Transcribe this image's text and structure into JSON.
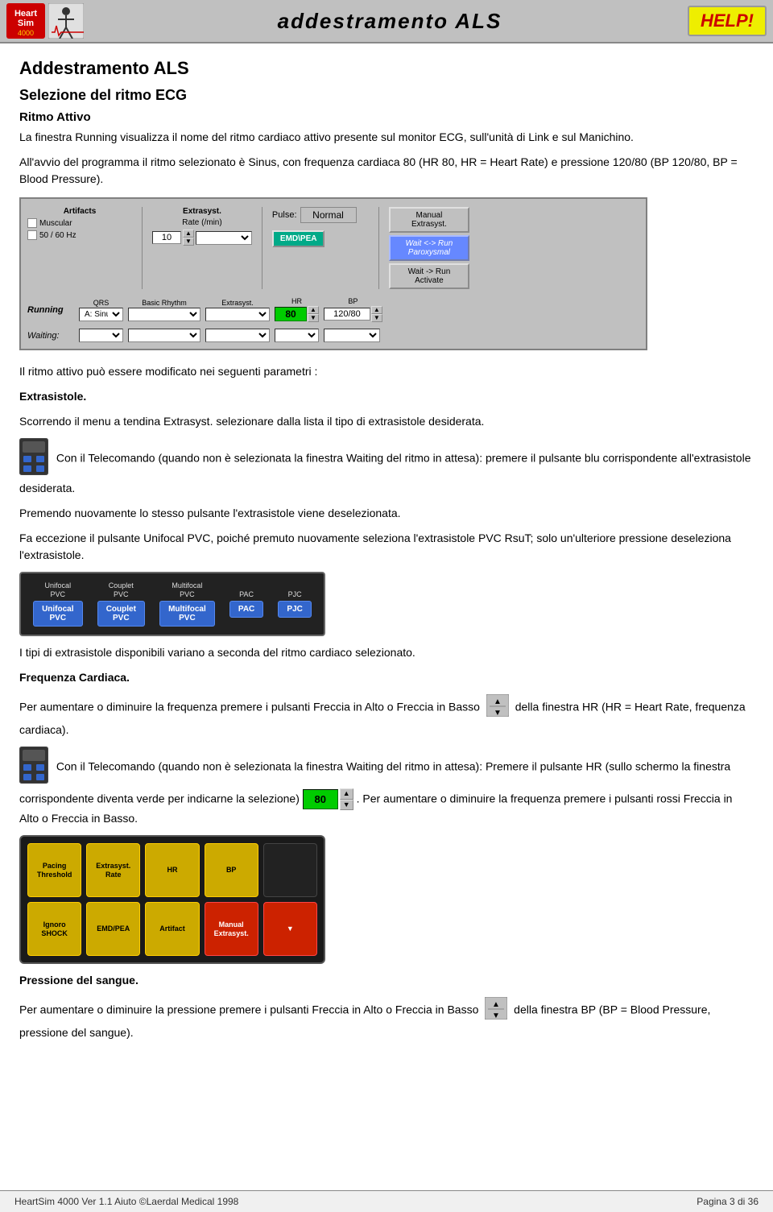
{
  "header": {
    "logo_text": "Heart\nSim",
    "logo_number": "4000",
    "title": "addestramento ALS",
    "help_label": "HELP!"
  },
  "page": {
    "title": "Addestramento ALS",
    "section1_title": "Selezione del ritmo ECG",
    "section1_sub": "Ritmo Attivo",
    "section1_p1": "La finestra Running visualizza il nome del ritmo cardiaco attivo presente sul monitor ECG, sull'unità di Link e sul Manichino.",
    "section1_p2": "All'avvio del programma il ritmo selezionato è Sinus, con frequenza cardiaca 80 (HR 80, HR = Heart Rate) e pressione 120/80 (BP 120/80, BP = Blood Pressure).",
    "panel": {
      "artifacts_label": "Artifacts",
      "muscular_label": "Muscular",
      "hz_label": "50 / 60 Hz",
      "extrasyst_label": "Extrasyst.",
      "rate_label": "Rate (/min)",
      "rate_value": "10",
      "pulse_label": "Pulse:",
      "normal_value": "Normal",
      "manual_extrasyst": "Manual\nExtrasyst.",
      "running_label": "Running",
      "waiting_label": "Waiting:",
      "qrs_label": "QRS",
      "basic_rhythm_label": "Basic Rhythm",
      "extrasyst_col_label": "Extrasyst.",
      "hr_label": "HR",
      "bp_label": "BP",
      "running_rhythm": "A: Sinus",
      "hr_value": "80",
      "bp_value": "120/80",
      "emd_pea_btn": "EMD\\PEA",
      "wait_run_paroxysmal": "Wait <-> Run\nParoxysmal",
      "wait_run_activate": "Wait -> Run\nActivate"
    },
    "p3": "Il ritmo attivo può essere modificato nei seguenti parametri :",
    "extrasistole_title": "Extrasistole.",
    "extrasistole_p1": "Scorrendo il menu a tendina Extrasyst. selezionare dalla lista il tipo di extrasistole desiderata.",
    "extrasistole_p2": "Con il Telecomando (quando non è selezionata la finestra Waiting del ritmo in attesa): premere il pulsante blu corrispondente all'extrasistole desiderata.",
    "extrasistole_p3": "Premendo nuovamente lo stesso pulsante l'extrasistole viene deselezionata.",
    "extrasistole_p4": "Fa eccezione il pulsante Unifocal PVC, poiché premuto nuovamente seleziona l'extrasistole PVC RsuT; solo un'ulteriore pressione deseleziona l'extrasistole.",
    "ext_buttons": [
      {
        "top": "Unifocal\nPVC",
        "label": "Unifocal\nPVC"
      },
      {
        "top": "Couplet\nPVC",
        "label": "Couplet\nPVC"
      },
      {
        "top": "Multifocal\nPVC",
        "label": "Multifocal\nPVC"
      },
      {
        "top": "PAC",
        "label": "PAC"
      },
      {
        "top": "PJC",
        "label": "PJC"
      }
    ],
    "ext_note": "I tipi di extrasistole disponibili variano a seconda del ritmo cardiaco selezionato.",
    "freq_title": "Frequenza Cardiaca.",
    "freq_p1": "Per aumentare o diminuire la frequenza premere i pulsanti Freccia in Alto o Freccia in Basso",
    "freq_p1b": "della finestra HR (HR = Heart Rate, frequenza cardiaca).",
    "freq_p2": "Con il Telecomando (quando non è selezionata la finestra Waiting del ritmo in attesa): Premere il pulsante HR (sullo schermo la finestra corrispondente diventa verde per indicarne la selezione)",
    "freq_p2b": ". Per aumentare o diminuire la frequenza premere i pulsanti rossi Freccia in Alto o Freccia in Basso.",
    "hr_inline_value": "80",
    "remote_buttons": [
      {
        "label": "Pacing\nThreshold",
        "color": "yellow"
      },
      {
        "label": "Extrasyst.\nRate",
        "color": "yellow"
      },
      {
        "label": "HR",
        "color": "yellow"
      },
      {
        "label": "BP",
        "color": "yellow"
      },
      {
        "label": "",
        "color": "gray"
      },
      {
        "label": "Ignoro\nSHOCK",
        "color": "yellow"
      },
      {
        "label": "EMD/PEA",
        "color": "yellow"
      },
      {
        "label": "Artifact",
        "color": "yellow"
      },
      {
        "label": "Manual\nExtrasyst.",
        "color": "red"
      },
      {
        "label": "▼",
        "color": "red"
      }
    ],
    "pressione_title": "Pressione del sangue.",
    "pressione_p1": "Per aumentare o diminuire la pressione premere i pulsanti Freccia in Alto o Freccia in Basso",
    "pressione_p1b": "della finestra BP (BP = Blood Pressure, pressione del sangue).",
    "footer": {
      "left": "HeartSim 4000 Ver 1.1 Aiuto   ©Laerdal Medical  1998",
      "right": "Pagina 3 di 36"
    }
  }
}
